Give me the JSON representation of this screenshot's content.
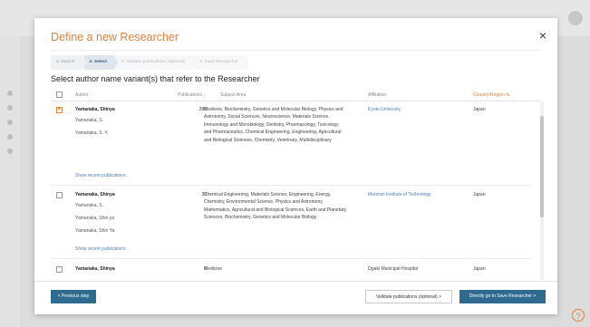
{
  "modal": {
    "title": "Define a new Researcher",
    "close": "×"
  },
  "steps": [
    {
      "label": "1. Search"
    },
    {
      "label": "2. Select"
    },
    {
      "label": "3. Validate publications (optional)"
    },
    {
      "label": "4. Save Researcher"
    }
  ],
  "subtitle": "Select author name variant(s) that refer to the Researcher",
  "table": {
    "headers": {
      "author": "Author",
      "publications": "Publications",
      "subject": "Subject Area",
      "affiliation": "Affiliation",
      "country": "Country/Region"
    },
    "sort_icon": "↓",
    "country_icon": "⇅",
    "rows": [
      {
        "checked": true,
        "name": "Yamanaka, Shinya",
        "variants": [
          "Yamanaka, S.",
          "Yamanaka, S. Y."
        ],
        "publications": "286",
        "subject": "Medicine, Biochemistry, Genetics and Molecular Biology, Physics and Astronomy, Social Sciences, Neuroscience, Materials Science, Immunology and Microbiology, Dentistry, Pharmacology, Toxicology and Pharmaceutics, Chemical Engineering, Engineering, Agricultural and Biological Sciences, Chemistry, Veterinary, Multidisciplinary",
        "affiliation": "Kyoto University",
        "country": "Japan",
        "show_recent": "Show recent publications"
      },
      {
        "checked": false,
        "name": "Yamanaka, Shinya",
        "variants": [
          "Yamanaka, S.",
          "Yamanaka, Shin ya",
          "Yamanaka, Shin Ya"
        ],
        "publications": "33",
        "subject": "Chemical Engineering, Materials Science, Engineering, Energy, Chemistry, Environmental Science, Physics and Astronomy, Mathematics, Agricultural and Biological Sciences, Earth and Planetary Sciences, Biochemistry, Genetics and Molecular Biology",
        "affiliation": "Muroran Institute of Technology",
        "country": "Japan",
        "show_recent": "Show recent publications"
      },
      {
        "checked": false,
        "name": "Yamanaka, Shinya",
        "variants": [],
        "publications": "6",
        "subject": "Medicine",
        "affiliation": "Ogaki Municipal Hospital",
        "country": "Japan"
      }
    ]
  },
  "buttons": {
    "previous": "< Previous step",
    "validate": "Validate publications (optional)  >",
    "save": "Directly go to Save Researcher  >"
  },
  "help_icon": "?"
}
